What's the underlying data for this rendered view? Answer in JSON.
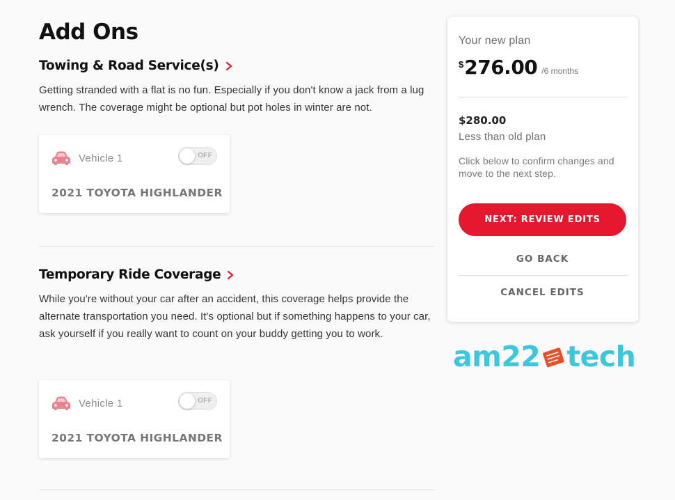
{
  "page": {
    "title": "Add Ons"
  },
  "sections": [
    {
      "heading": "Towing & Road Service(s)",
      "description": "Getting stranded with a flat is no fun. Especially if you don't know a jack from a lug wrench. The coverage might be optional but pot holes in winter are not.",
      "vehicle": {
        "label": "Vehicle 1",
        "toggle_text": "OFF",
        "toggle_on": false,
        "name": "2021 TOYOTA HIGHLANDER"
      }
    },
    {
      "heading": "Temporary Ride Coverage",
      "description": "While you're without your car after an accident, this coverage helps provide the alternate transportation you need. It's optional but if something happens to your car, ask yourself if you really want to count on your buddy getting you to work.",
      "vehicle": {
        "label": "Vehicle 1",
        "toggle_text": "OFF",
        "toggle_on": false,
        "name": "2021 TOYOTA HIGHLANDER"
      }
    }
  ],
  "plan": {
    "label": "Your new plan",
    "currency": "$",
    "amount": "276.00",
    "period": "/6 months",
    "old_price": "$280.00",
    "comparison": "Less than old plan",
    "confirm_text": "Click below to confirm changes and move to the next step.",
    "next_label": "NEXT: REVIEW EDITS",
    "back_label": "GO BACK",
    "cancel_label": "CANCEL EDITS"
  },
  "watermark": {
    "left": "am22",
    "right": "tech"
  },
  "icons": {
    "chevron": "chevron-right-icon",
    "car": "car-icon",
    "logo": "pencil-note-icon"
  },
  "colors": {
    "accent": "#e5172e",
    "car_icon": "#e8838f",
    "watermark": "#3ec6dc",
    "logo_mark": "#e8502a"
  }
}
